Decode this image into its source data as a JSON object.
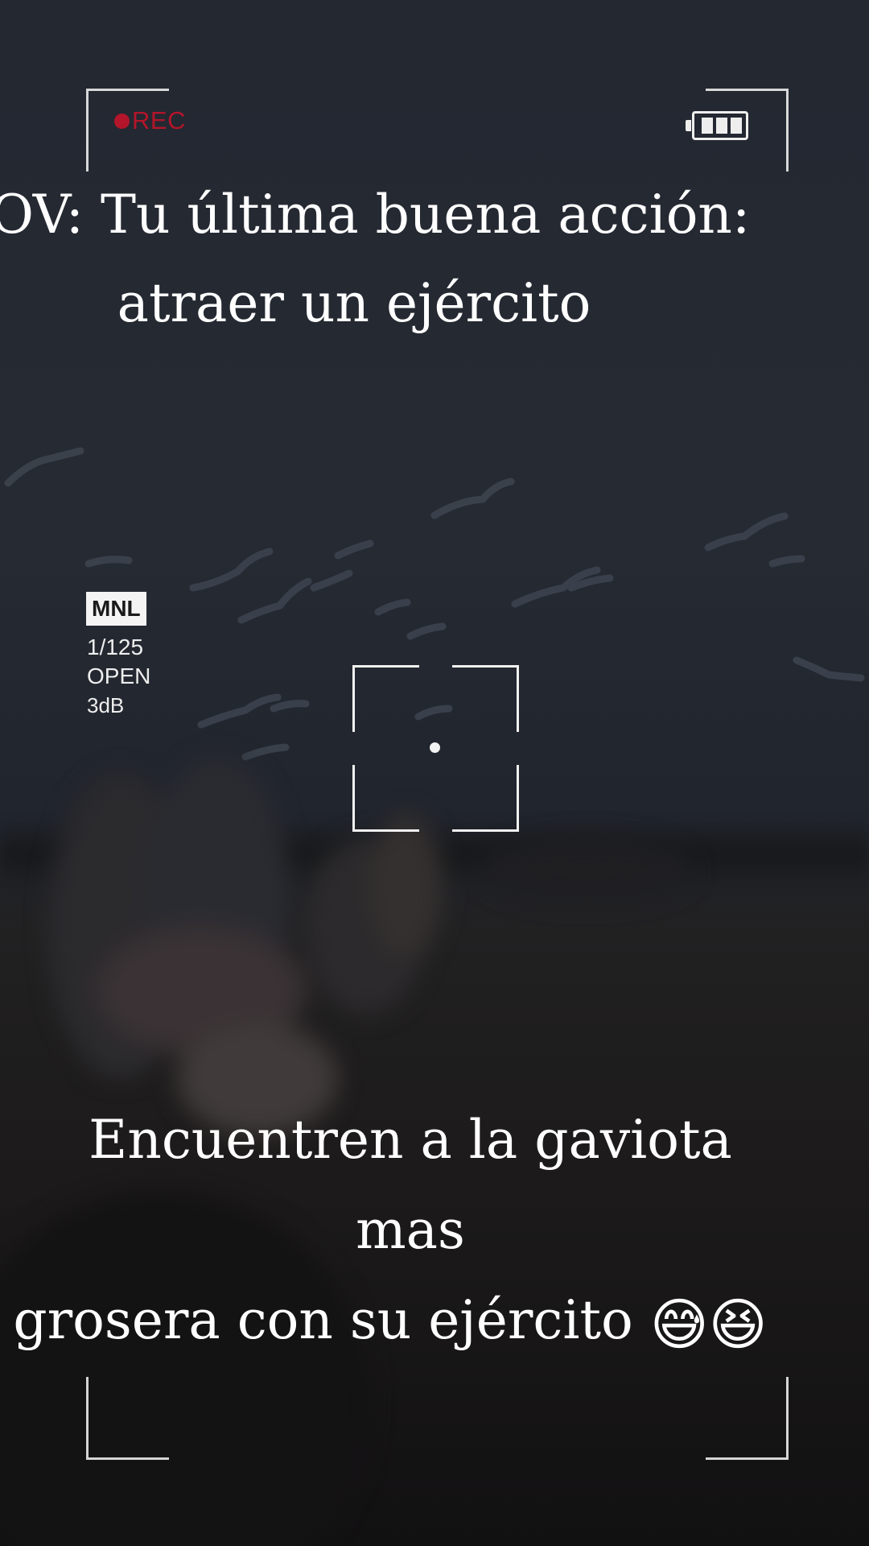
{
  "recorder": {
    "rec_label": "REC",
    "battery_level": 1.0,
    "mode_badge": "MNL",
    "shutter": "1/125",
    "aperture": "OPEN",
    "gain": "3dB"
  },
  "overlay_text": {
    "title_line1": "OV: Tu última buena acción:",
    "title_line2": "atraer un ejército",
    "caption_line1": "Encuentren a la gaviota mas",
    "caption_line2": "grosera con su ejército",
    "caption_emoji": "😅😆"
  },
  "colors": {
    "rec_red": "#b3152a",
    "text_white": "#ffffff",
    "background_dark": "#1c1f27"
  }
}
